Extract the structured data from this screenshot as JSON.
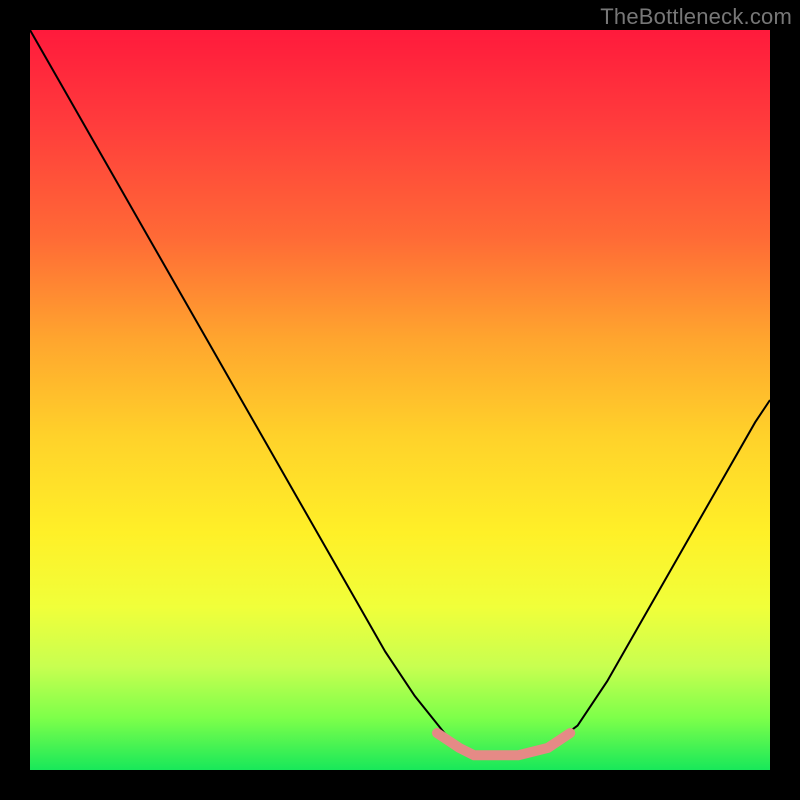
{
  "watermark": "TheBottleneck.com",
  "chart_data": {
    "type": "line",
    "title": "",
    "xlabel": "",
    "ylabel": "",
    "xlim": [
      0,
      100
    ],
    "ylim": [
      0,
      100
    ],
    "grid": false,
    "legend": false,
    "background_gradient": {
      "direction": "top-to-bottom",
      "stops": [
        {
          "pos": 0.0,
          "color": "#ff1a3c"
        },
        {
          "pos": 0.28,
          "color": "#ff6a36"
        },
        {
          "pos": 0.55,
          "color": "#ffd22a"
        },
        {
          "pos": 0.78,
          "color": "#f0ff3a"
        },
        {
          "pos": 1.0,
          "color": "#18e85a"
        }
      ]
    },
    "series": [
      {
        "name": "bottleneck-curve",
        "color": "#000000",
        "stroke_width": 2,
        "x": [
          0,
          4,
          8,
          12,
          16,
          20,
          24,
          28,
          32,
          36,
          40,
          44,
          48,
          52,
          56,
          58,
          60,
          62,
          66,
          70,
          74,
          78,
          82,
          86,
          90,
          94,
          98,
          100
        ],
        "y": [
          100,
          93,
          86,
          79,
          72,
          65,
          58,
          51,
          44,
          37,
          30,
          23,
          16,
          10,
          5,
          3,
          2,
          2,
          2,
          3,
          6,
          12,
          19,
          26,
          33,
          40,
          47,
          50
        ]
      },
      {
        "name": "flat-region-highlight",
        "color": "#e58a86",
        "stroke_width": 10,
        "linecap": "round",
        "x": [
          55,
          58,
          60,
          62,
          66,
          70,
          73
        ],
        "y": [
          5,
          3,
          2,
          2,
          2,
          3,
          5
        ]
      }
    ]
  }
}
